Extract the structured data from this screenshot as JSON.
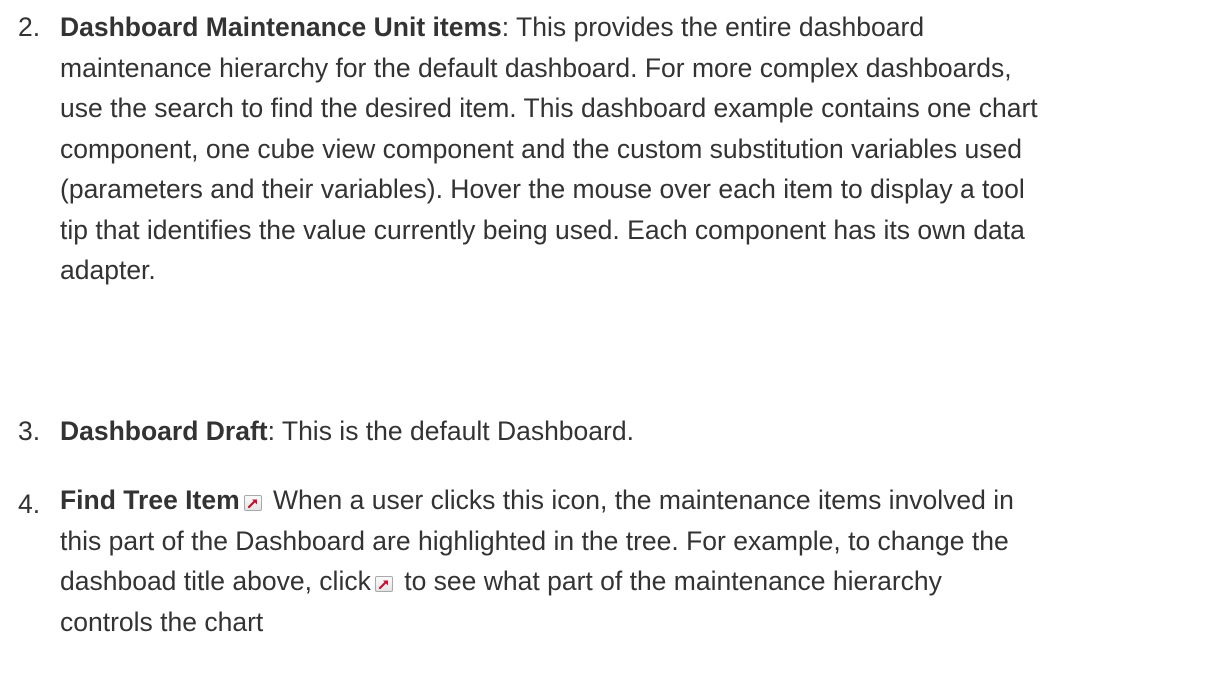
{
  "items": [
    {
      "number": "2.",
      "label": "Dashboard Maintenance Unit items",
      "separator": ":",
      "lines": [
        " This provides the entire dashboard",
        "maintenance hierarchy for the default dashboard. For more complex dashboards,",
        "use the search to find the desired item. This dashboard example contains one chart",
        "component, one cube view component and the custom substitution variables used",
        "(parameters and their variables). Hover the mouse over each item to display a tool",
        "tip that identifies the value currently being used. Each component has its own data",
        "adapter."
      ]
    },
    {
      "number": "3.",
      "label": "Dashboard Draft",
      "separator": ":",
      "lines": [
        " This is the default Dashboard."
      ]
    },
    {
      "number": "4.",
      "label": "Find Tree Item",
      "icon": "find-tree-item-icon",
      "lines": [
        " When a user clicks this icon, the maintenance items involved in",
        "this part of the Dashboard are highlighted in the tree. For example, to change the",
        "dashboad title above, click",
        " to see what part of the maintenance hierarchy",
        "controls the chart"
      ]
    }
  ]
}
